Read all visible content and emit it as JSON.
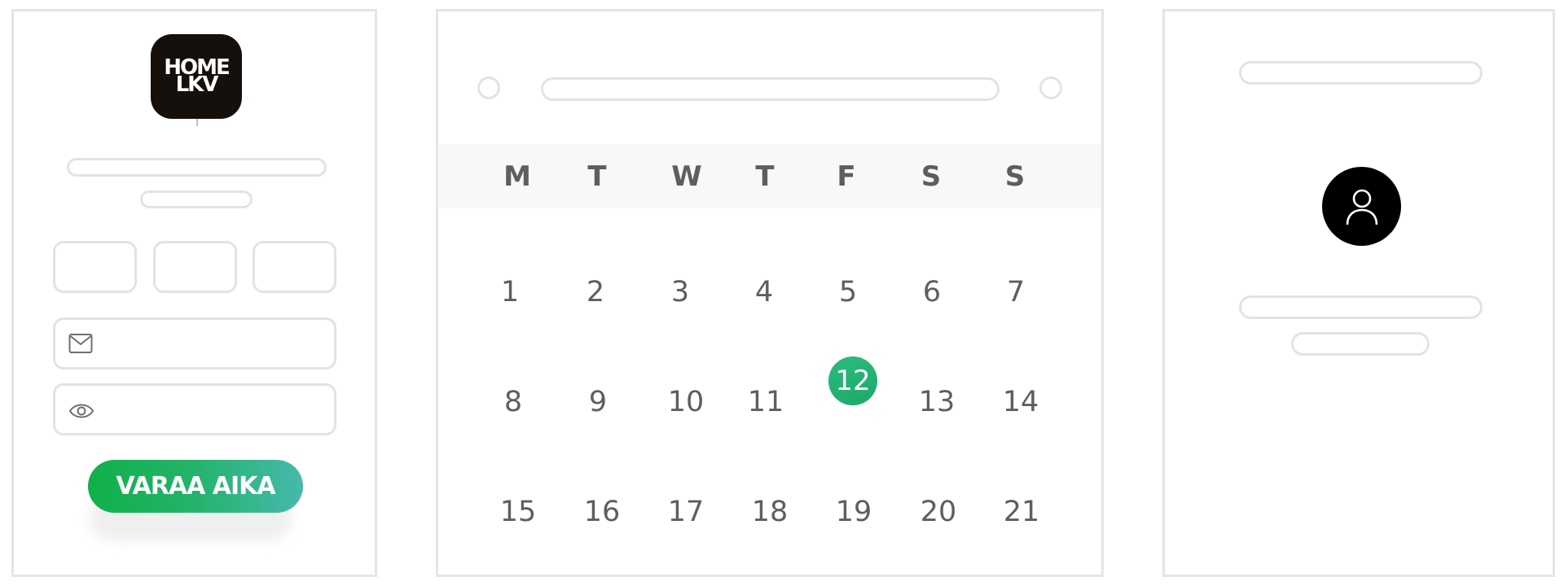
{
  "login": {
    "logo": {
      "line1": "HOME",
      "line2": "LKV"
    },
    "cta_label": "VARAA AIKA",
    "icons": {
      "email": "envelope-icon",
      "password": "eye-icon"
    }
  },
  "calendar": {
    "weekdays": [
      "M",
      "T",
      "W",
      "T",
      "F",
      "S",
      "S"
    ],
    "weeks": [
      [
        "1",
        "2",
        "3",
        "4",
        "5",
        "6",
        "7"
      ],
      [
        "8",
        "9",
        "10",
        "11",
        "12",
        "13",
        "14"
      ],
      [
        "15",
        "16",
        "17",
        "18",
        "19",
        "20",
        "21"
      ]
    ],
    "selected_day": "12",
    "accent_color": "#1faa6a"
  },
  "profile": {
    "avatar_icon": "user-icon"
  },
  "colors": {
    "cta_gradient_start": "#10b049",
    "cta_gradient_end": "#47b9ad",
    "logo_background": "#15100b",
    "placeholder_border": "#e3e3e3"
  }
}
